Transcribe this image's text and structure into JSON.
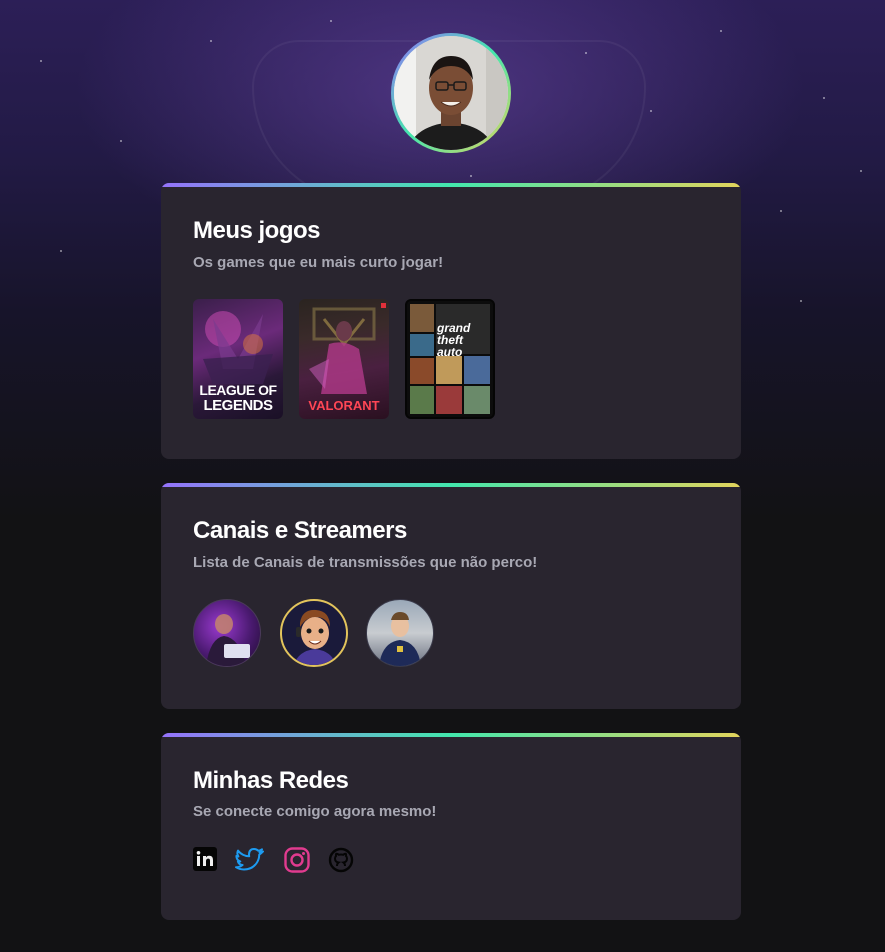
{
  "profile": {
    "avatar_alt": "profile-photo"
  },
  "games_section": {
    "title": "Meus jogos",
    "subtitle": "Os games que eu mais curto jogar!",
    "games": [
      {
        "name": "League of Legends",
        "cover_line1": "LEAGUE OF",
        "cover_line2": "LEGENDS"
      },
      {
        "name": "Valorant",
        "cover_text": "VALORANT"
      },
      {
        "name": "Grand Theft Auto V",
        "cover_line1": "grand",
        "cover_line2": "theft",
        "cover_line3": "auto"
      }
    ]
  },
  "streamers_section": {
    "title": "Canais e Streamers",
    "subtitle": "Lista de Canais de transmissões que não perco!",
    "streamers": [
      {
        "icon": "streamer-1-avatar"
      },
      {
        "icon": "streamer-2-avatar"
      },
      {
        "icon": "streamer-3-avatar"
      }
    ]
  },
  "networks_section": {
    "title": "Minhas Redes",
    "subtitle": "Se conecte comigo agora mesmo!",
    "links": [
      {
        "icon": "linkedin-icon",
        "color": "#0a0a0a"
      },
      {
        "icon": "twitter-icon",
        "color": "#1d9bf0"
      },
      {
        "icon": "instagram-icon",
        "color": "#e1306c"
      },
      {
        "icon": "github-icon",
        "color": "#0a0a0a"
      }
    ]
  },
  "theme": {
    "accent_gradient": [
      "#9572fc",
      "#43e7ad",
      "#e2d45c"
    ],
    "card_bg": "#29252f",
    "page_bg": "#121214"
  }
}
